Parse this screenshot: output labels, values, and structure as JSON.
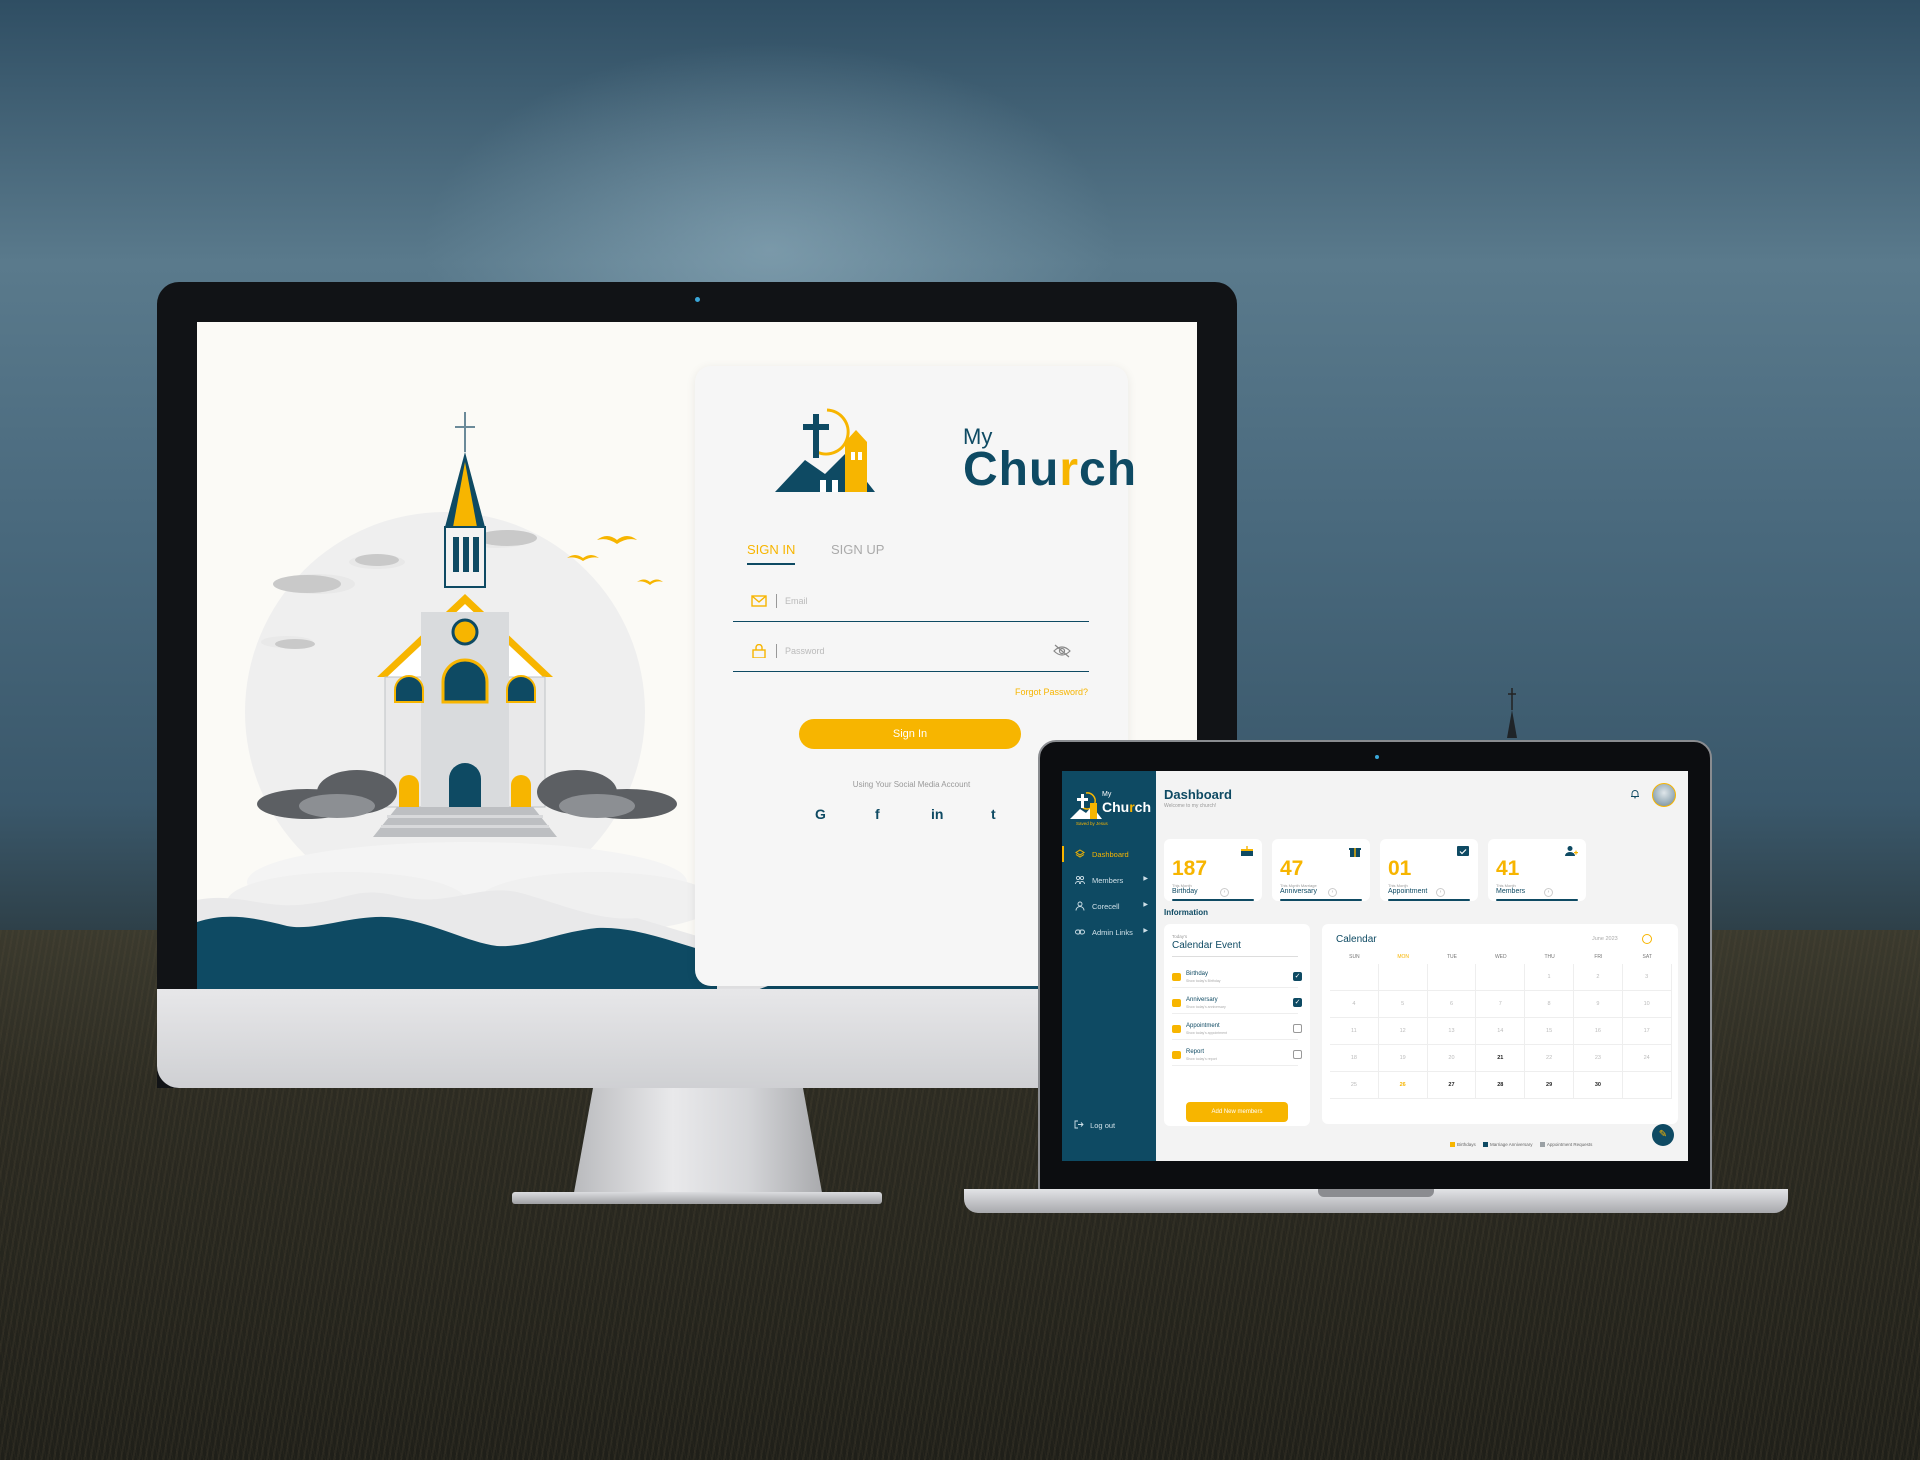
{
  "colors": {
    "accent": "#f7b500",
    "brand": "#0e4a63",
    "card": "#ffffff",
    "canvas": "#f3f3f3"
  },
  "login": {
    "logo_my": "My",
    "logo_church_a": "Chu",
    "logo_church_r": "r",
    "logo_church_b": "ch",
    "tab_signin": "SIGN IN",
    "tab_signup": "SIGN UP",
    "email_placeholder": "Email",
    "password_placeholder": "Password",
    "forgot": "Forgot Password?",
    "signin_button": "Sign In",
    "social_caption": "Using Your Social Media Account",
    "social": [
      {
        "icon": "google-icon",
        "glyph": "G"
      },
      {
        "icon": "facebook-icon",
        "glyph": "f"
      },
      {
        "icon": "linkedin-icon",
        "glyph": "in"
      },
      {
        "icon": "twitter-icon",
        "glyph": "t"
      }
    ]
  },
  "dashboard": {
    "sidebar": {
      "logo_my": "My",
      "logo_church_a": "Chu",
      "logo_church_r": "r",
      "logo_church_b": "ch",
      "tagline": "Saved by Jesus",
      "items": [
        {
          "label": "Dashboard",
          "icon": "layers-icon",
          "active": true
        },
        {
          "label": "Members",
          "icon": "users-icon",
          "has_arrow": true
        },
        {
          "label": "Corecell",
          "icon": "person-icon",
          "has_arrow": true
        },
        {
          "label": "Admin Links",
          "icon": "link-icon",
          "has_arrow": true
        }
      ],
      "logout": "Log out"
    },
    "header": {
      "title": "Dashboard",
      "subtitle": "Welcome to my church!"
    },
    "stats": [
      {
        "value": "187",
        "caption": "This Month",
        "label": "Birthday",
        "icon": "cake-icon"
      },
      {
        "value": "47",
        "caption": "This Month Marriage",
        "label": "Anniversary",
        "icon": "gift-icon"
      },
      {
        "value": "01",
        "caption": "This Month",
        "label": "Appointment",
        "icon": "calendar-check-icon"
      },
      {
        "value": "41",
        "caption": "This Month",
        "label": "Members",
        "icon": "user-add-icon"
      }
    ],
    "info_title": "Information",
    "events": {
      "today": "Today's",
      "title": "Calendar Event",
      "rows": [
        {
          "title": "Birthday",
          "sub": "Show today's Birthday",
          "checked": true
        },
        {
          "title": "Anniversary",
          "sub": "Show today's anniversary",
          "checked": true
        },
        {
          "title": "Appointment",
          "sub": "Show today's appointment",
          "checked": false
        },
        {
          "title": "Report",
          "sub": "Show today's report",
          "checked": false
        }
      ],
      "add_button": "Add New members"
    },
    "calendar": {
      "title": "Calendar",
      "month": "June 2023",
      "days": [
        "SUN",
        "MON",
        "TUE",
        "WED",
        "THU",
        "FRI",
        "SAT"
      ],
      "weeks": [
        [
          "",
          "",
          "",
          "",
          "1",
          "2",
          "3"
        ],
        [
          "4",
          "5",
          "6",
          "7",
          "8",
          "9",
          "10"
        ],
        [
          "11",
          "12",
          "13",
          "14",
          "15",
          "16",
          "17"
        ],
        [
          "18",
          "19",
          "20",
          "21",
          "22",
          "23",
          "24"
        ],
        [
          "25",
          "26",
          "27",
          "28",
          "29",
          "30",
          ""
        ]
      ],
      "highlight_today": "26",
      "bold_days": [
        "21",
        "27",
        "28",
        "29",
        "30"
      ],
      "legend": [
        "Birthdays",
        "Marriage Anniversary",
        "Appointment Requests"
      ]
    }
  }
}
